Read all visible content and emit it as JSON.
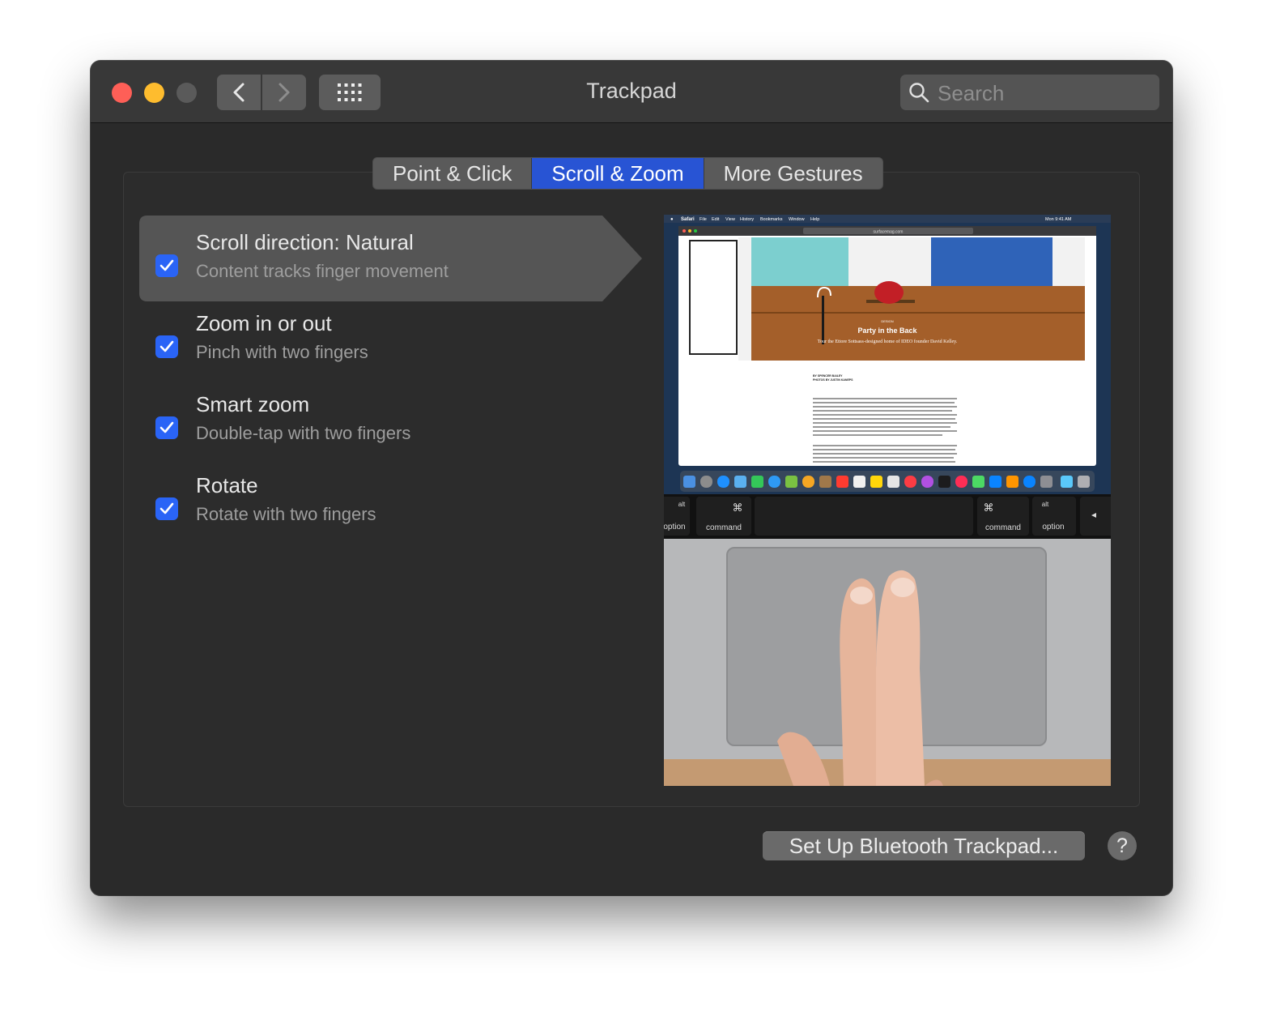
{
  "window": {
    "title": "Trackpad"
  },
  "search": {
    "placeholder": "Search"
  },
  "tabs": [
    {
      "label": "Point & Click"
    },
    {
      "label": "Scroll & Zoom"
    },
    {
      "label": "More Gestures"
    }
  ],
  "options": [
    {
      "title": "Scroll direction: Natural",
      "subtitle": "Content tracks finger movement",
      "checked": true
    },
    {
      "title": "Zoom in or out",
      "subtitle": "Pinch with two fingers",
      "checked": true
    },
    {
      "title": "Smart zoom",
      "subtitle": "Double-tap with two fingers",
      "checked": true
    },
    {
      "title": "Rotate",
      "subtitle": "Rotate with two fingers",
      "checked": true
    }
  ],
  "preview": {
    "menubar": [
      "Safari",
      "File",
      "Edit",
      "View",
      "History",
      "Bookmarks",
      "Window",
      "Help"
    ],
    "clock": "Mon 9:41 AM",
    "url": "surfacemag.com",
    "article_kicker": "DESIGN",
    "article_title": "Party in the Back",
    "article_subtitle": "Tour the Ettore Sottsass-designed home of IDEO founder David Kelley.",
    "byline_1": "BY SPENCER BAILEY",
    "byline_2": "PHOTOS BY JUSTIN KANEPS",
    "keys": {
      "left_option_top": "alt",
      "left_option": "option",
      "left_command_symbol": "⌘",
      "left_command": "command",
      "right_command_symbol": "⌘",
      "right_command": "command",
      "right_option_top": "alt",
      "right_option": "option"
    }
  },
  "buttons": {
    "bluetooth": "Set Up Bluetooth Trackpad...",
    "help": "?"
  },
  "colors": {
    "accent": "#2854d4",
    "checkbox": "#2a64f6",
    "background": "#2a2a2a"
  }
}
